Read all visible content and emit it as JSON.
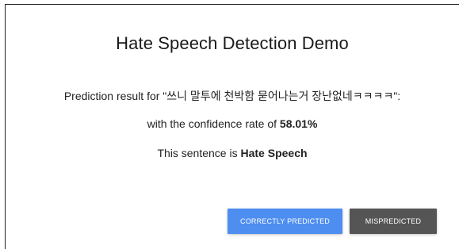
{
  "title": "Hate Speech Detection Demo",
  "prediction": {
    "prefix": "Prediction result for \"",
    "sentence": "쓰니 말투에 천박함 묻어나는거 장난없네ㅋㅋㅋㅋ",
    "suffix": "\":"
  },
  "confidence": {
    "prefix": "with the confidence rate of ",
    "value": "58.01%"
  },
  "result": {
    "prefix": "This sentence is ",
    "label": "Hate Speech"
  },
  "buttons": {
    "correct_label": "CORRECTLY PREDICTED",
    "mis_label": "MISPREDICTED"
  },
  "colors": {
    "correct_button": "#4d8ef0",
    "mis_button": "#555555"
  }
}
